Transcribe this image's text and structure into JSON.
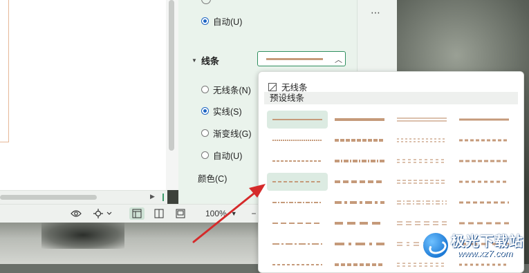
{
  "panel": {
    "top_radio_partial": "",
    "auto_top": "自动(U)",
    "line_section": "线条",
    "line_options": [
      {
        "label": "无线条(N)",
        "checked": false
      },
      {
        "label": "实线(S)",
        "checked": true
      },
      {
        "label": "渐变线(G)",
        "checked": false
      },
      {
        "label": "自动(U)",
        "checked": false
      }
    ],
    "color_label": "颜色(C)",
    "more_icon": "⋯"
  },
  "popup": {
    "no_line": "无线条",
    "preset_header": "预设线条",
    "line_color": "#c59a7a",
    "selected_color": "#dcebe2"
  },
  "statusbar": {
    "zoom": "100%",
    "minus": "−"
  },
  "watermark": {
    "name": "极光下载站",
    "url": "www.xz7.com"
  },
  "colors": {
    "accent": "#2f8f5f",
    "radio_on": "#1f66c4",
    "panel_bg": "#eaf3ec",
    "arrow": "#d52a2a"
  }
}
